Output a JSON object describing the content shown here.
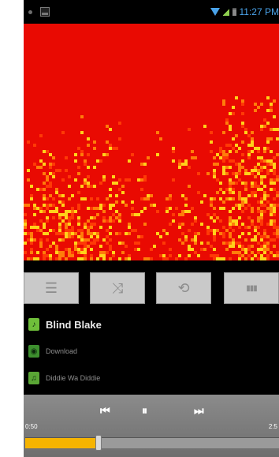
{
  "status_bar": {
    "time": "11:27 PM",
    "icons": [
      "notification-dot-icon",
      "image-icon",
      "wifi-icon",
      "signal-icon",
      "battery-icon"
    ]
  },
  "art": {
    "background": "#e90a02",
    "highlight": "#ffd21a"
  },
  "controls": {
    "buttons": [
      {
        "name": "playlist-button",
        "icon": "list-icon",
        "glyph": "☰"
      },
      {
        "name": "shuffle-button",
        "icon": "shuffle-icon",
        "glyph": "⤨"
      },
      {
        "name": "repeat-button",
        "icon": "repeat-icon",
        "glyph": "⟲"
      },
      {
        "name": "equalizer-button",
        "icon": "equalizer-icon",
        "glyph": "▮▮▮"
      }
    ]
  },
  "info": {
    "artist": "Blind Blake",
    "album": "Download",
    "song": "Diddie Wa Diddie"
  },
  "player": {
    "prev_glyph": "⏮",
    "pause_glyph": "⏸",
    "next_glyph": "⏭",
    "elapsed": "0:50",
    "duration": "2:5",
    "progress": 0.29,
    "accent": "#f6b400"
  }
}
